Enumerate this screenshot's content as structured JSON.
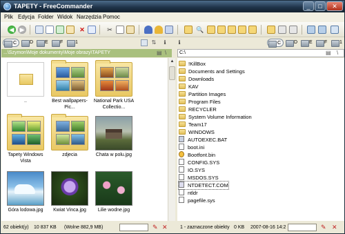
{
  "window": {
    "title": "TAPETY - FreeCommander",
    "min": "_",
    "max": "□",
    "close": "✕"
  },
  "menu": [
    "Plik",
    "Edycja",
    "Folder",
    "Widok",
    "Narzędzia",
    "Pomoc"
  ],
  "drives": {
    "left": [
      "C",
      "D",
      "E",
      "F",
      "1"
    ],
    "right": [
      "C",
      "D",
      "E",
      "F",
      "1"
    ]
  },
  "left": {
    "path": "...\\Szymon\\Moje dokumenty\\Moje obrazy\\TAPETY",
    "items": [
      {
        "label": "..",
        "kind": "up"
      },
      {
        "label": "Best wallpapers-Pic...",
        "kind": "folder"
      },
      {
        "label": "National Park USA Collectio...",
        "kind": "folder"
      },
      {
        "label": "Tapety Windows Vista",
        "kind": "folder"
      },
      {
        "label": "zdjecia",
        "kind": "folder"
      },
      {
        "label": "Chata w polu.jpg",
        "kind": "image"
      },
      {
        "label": "Góra lodowa.jpg",
        "kind": "image"
      },
      {
        "label": "Kwiat Vinca.jpg",
        "kind": "image"
      },
      {
        "label": "Lilie wodne.jpg",
        "kind": "image"
      }
    ],
    "status": {
      "count": "62 obiekt(y)",
      "size": "10 837 KB",
      "free": "(Wolne 882,9 MB)"
    }
  },
  "right": {
    "path": "C:\\",
    "items": [
      {
        "label": "!KillBox",
        "kind": "folder"
      },
      {
        "label": "Documents and Settings",
        "kind": "folder"
      },
      {
        "label": "Downloads",
        "kind": "folder"
      },
      {
        "label": "KAV",
        "kind": "folder"
      },
      {
        "label": "Partition Images",
        "kind": "folder"
      },
      {
        "label": "Program Files",
        "kind": "folder"
      },
      {
        "label": "RECYCLER",
        "kind": "folder"
      },
      {
        "label": "System Volume Information",
        "kind": "folder"
      },
      {
        "label": "Team17",
        "kind": "folder"
      },
      {
        "label": "WINDOWS",
        "kind": "folder"
      },
      {
        "label": "AUTOEXEC.BAT",
        "kind": "bat"
      },
      {
        "label": "boot.ini",
        "kind": "file"
      },
      {
        "label": "Bootfont.bin",
        "kind": "bin"
      },
      {
        "label": "CONFIG.SYS",
        "kind": "file"
      },
      {
        "label": "IO.SYS",
        "kind": "file"
      },
      {
        "label": "MSDOS.SYS",
        "kind": "file"
      },
      {
        "label": "NTDETECT.COM",
        "kind": "com"
      },
      {
        "label": "ntldr",
        "kind": "file"
      },
      {
        "label": "pagefile.sys",
        "kind": "file"
      }
    ],
    "status": {
      "selected": "1 - zaznaczone obiekty",
      "size": "0 KB",
      "date": "2007-08-16 14:2"
    }
  },
  "colors": {
    "pathbar": "#a9c07e",
    "titlebar": "#20344a",
    "statusbar": "#ece9d8"
  }
}
